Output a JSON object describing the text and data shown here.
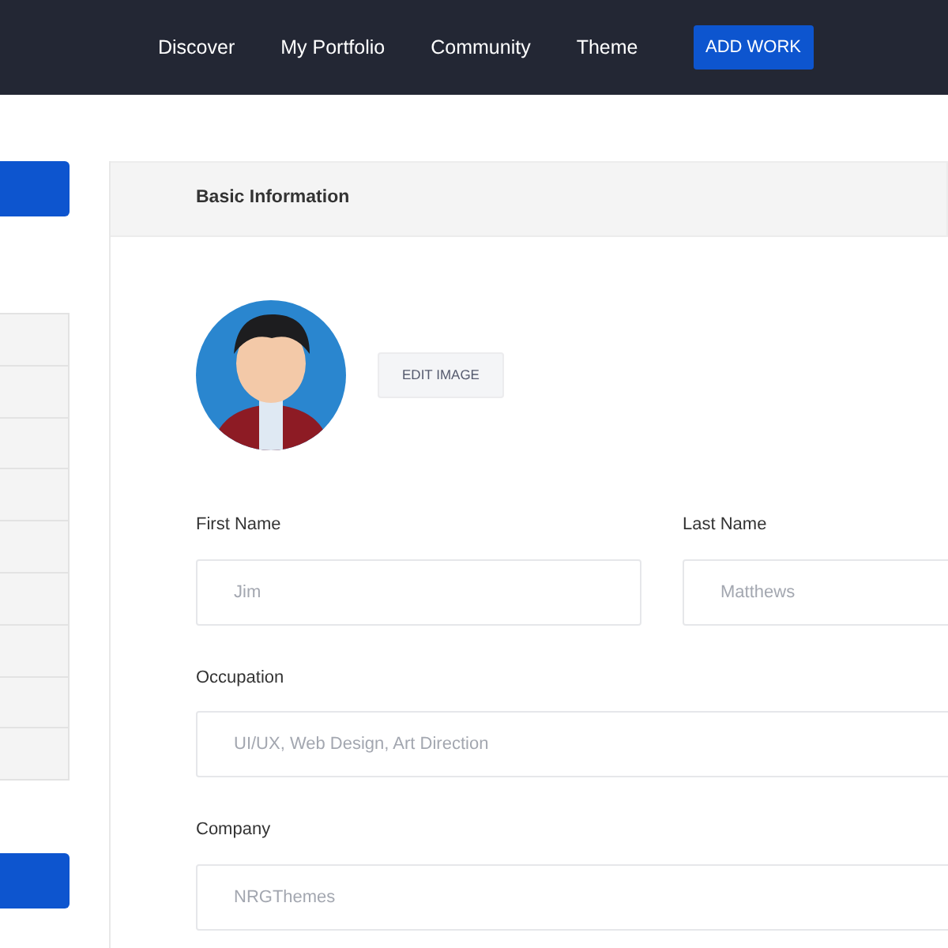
{
  "navbar": {
    "links": [
      "Discover",
      "My Portfolio",
      "Community",
      "Theme"
    ],
    "action_button": "ADD WORK"
  },
  "sidebar": {
    "blocks": [
      {
        "kind": "button"
      },
      {
        "kind": "list",
        "items": [
          {
            "kind": "blank"
          },
          {
            "kind": "blank"
          },
          {
            "kind": "blank"
          },
          {
            "kind": "blank"
          },
          {
            "kind": "blank"
          },
          {
            "kind": "blank"
          },
          {
            "kind": "blank"
          },
          {
            "kind": "blank"
          },
          {
            "kind": "blank"
          }
        ]
      },
      {
        "kind": "button"
      }
    ]
  },
  "panel": {
    "title": "Basic Information",
    "avatar": {
      "kind": "avatar"
    },
    "edit_image_button": "EDIT IMAGE",
    "fields": [
      {
        "label": "First Name",
        "placeholder": "Jim",
        "kind": "half"
      },
      {
        "label": "Last Name",
        "placeholder": "Matthews",
        "kind": "half"
      },
      {
        "label": "Occupation",
        "placeholder": "UI/UX, Web Design, Art Direction",
        "kind": "full"
      },
      {
        "label": "Company",
        "placeholder": "NRGThemes",
        "kind": "full"
      }
    ]
  }
}
